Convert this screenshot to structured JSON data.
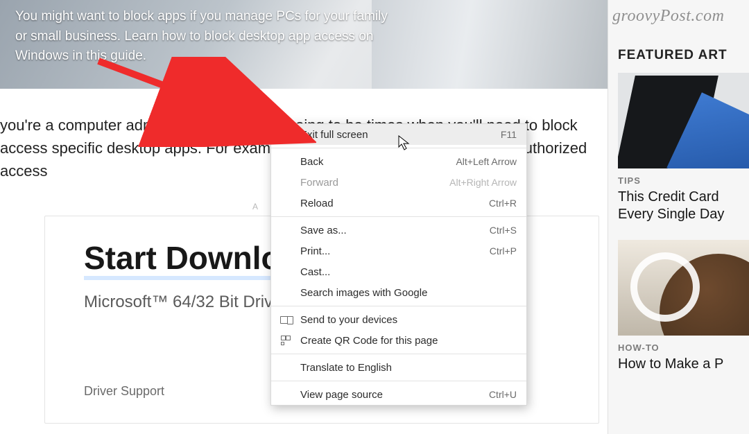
{
  "hero": {
    "text": "You might want to block apps if you manage PCs for your family or small business. Learn how to block desktop app access on Windows in this guide."
  },
  "article": {
    "para": "you're a computer administrator, there are going to be times when you'll need to block access specific desktop apps. For example, you                                                          like owerShell to prevent unauthorized access"
  },
  "ad": {
    "label": "A",
    "title": "Start Downloa",
    "subtitle": "Microsoft™ 64/32 Bit Drive",
    "footer": "Driver Support"
  },
  "menu": {
    "items": [
      {
        "label": "Exit full screen",
        "shortcut": "F11",
        "highlight": true
      },
      {
        "sep": true
      },
      {
        "label": "Back",
        "shortcut": "Alt+Left Arrow"
      },
      {
        "label": "Forward",
        "shortcut": "Alt+Right Arrow",
        "disabled": true
      },
      {
        "label": "Reload",
        "shortcut": "Ctrl+R"
      },
      {
        "sep": true
      },
      {
        "label": "Save as...",
        "shortcut": "Ctrl+S"
      },
      {
        "label": "Print...",
        "shortcut": "Ctrl+P"
      },
      {
        "label": "Cast..."
      },
      {
        "label": "Search images with Google"
      },
      {
        "sep": true
      },
      {
        "label": "Send to your devices",
        "icon": "devices"
      },
      {
        "label": "Create QR Code for this page",
        "icon": "qr"
      },
      {
        "sep": true
      },
      {
        "label": "Translate to English"
      },
      {
        "sep": true
      },
      {
        "label": "View page source",
        "shortcut": "Ctrl+U"
      }
    ]
  },
  "sidebar": {
    "brand": "groovyPost.com",
    "section": "FEATURED ART",
    "cards": [
      {
        "category": "TIPS",
        "title": "This Credit Card Every Single Day"
      },
      {
        "category": "HOW-TO",
        "title": "How to Make a P"
      }
    ]
  }
}
